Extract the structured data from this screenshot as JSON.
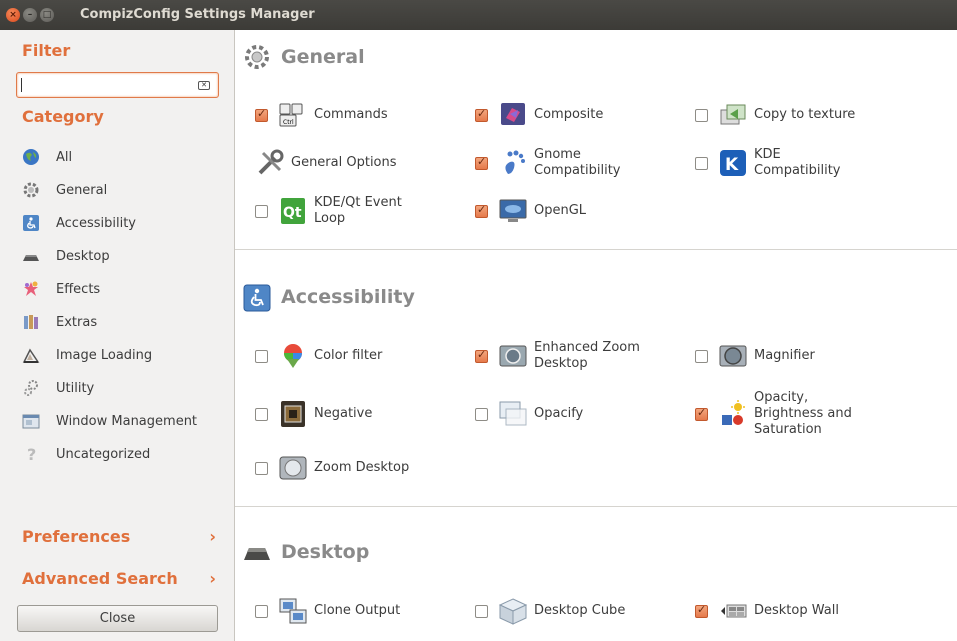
{
  "window": {
    "title": "CompizConfig Settings Manager"
  },
  "sidebar": {
    "filter_heading": "Filter",
    "filter_value": "",
    "category_heading": "Category",
    "categories": [
      {
        "label": "All",
        "icon": "globe-icon"
      },
      {
        "label": "General",
        "icon": "gear-icon"
      },
      {
        "label": "Accessibility",
        "icon": "accessibility-icon"
      },
      {
        "label": "Desktop",
        "icon": "desktop-icon"
      },
      {
        "label": "Effects",
        "icon": "effects-icon"
      },
      {
        "label": "Extras",
        "icon": "extras-icon"
      },
      {
        "label": "Image Loading",
        "icon": "image-loading-icon"
      },
      {
        "label": "Utility",
        "icon": "utility-icon"
      },
      {
        "label": "Window Management",
        "icon": "window-management-icon"
      },
      {
        "label": "Uncategorized",
        "icon": "uncategorized-icon"
      }
    ],
    "preferences_label": "Preferences",
    "advanced_search_label": "Advanced Search",
    "close_label": "Close"
  },
  "sections": [
    {
      "title": "General",
      "plugins": [
        {
          "label": "Commands",
          "checked": true,
          "has_checkbox": true
        },
        {
          "label": "Composite",
          "checked": true,
          "has_checkbox": true
        },
        {
          "label": "Copy to texture",
          "checked": false,
          "has_checkbox": true
        },
        {
          "label": "General Options",
          "checked": false,
          "has_checkbox": false
        },
        {
          "label": "Gnome\nCompatibility",
          "checked": true,
          "has_checkbox": true
        },
        {
          "label": "KDE\nCompatibility",
          "checked": false,
          "has_checkbox": true
        },
        {
          "label": "KDE/Qt Event\nLoop",
          "checked": false,
          "has_checkbox": true
        },
        {
          "label": "OpenGL",
          "checked": true,
          "has_checkbox": true
        }
      ]
    },
    {
      "title": "Accessibility",
      "plugins": [
        {
          "label": "Color filter",
          "checked": false,
          "has_checkbox": true
        },
        {
          "label": "Enhanced Zoom\nDesktop",
          "checked": true,
          "has_checkbox": true
        },
        {
          "label": "Magnifier",
          "checked": false,
          "has_checkbox": true
        },
        {
          "label": "Negative",
          "checked": false,
          "has_checkbox": true
        },
        {
          "label": "Opacify",
          "checked": false,
          "has_checkbox": true
        },
        {
          "label": "Opacity,\nBrightness and\nSaturation",
          "checked": true,
          "has_checkbox": true
        },
        {
          "label": "Zoom Desktop",
          "checked": false,
          "has_checkbox": true
        }
      ]
    },
    {
      "title": "Desktop",
      "plugins": [
        {
          "label": "Clone Output",
          "checked": false,
          "has_checkbox": true
        },
        {
          "label": "Desktop Cube",
          "checked": false,
          "has_checkbox": true
        },
        {
          "label": "Desktop Wall",
          "checked": true,
          "has_checkbox": true
        }
      ]
    }
  ],
  "colors": {
    "accent": "#e0703c",
    "checkbox_checked": "#e57a4c"
  }
}
